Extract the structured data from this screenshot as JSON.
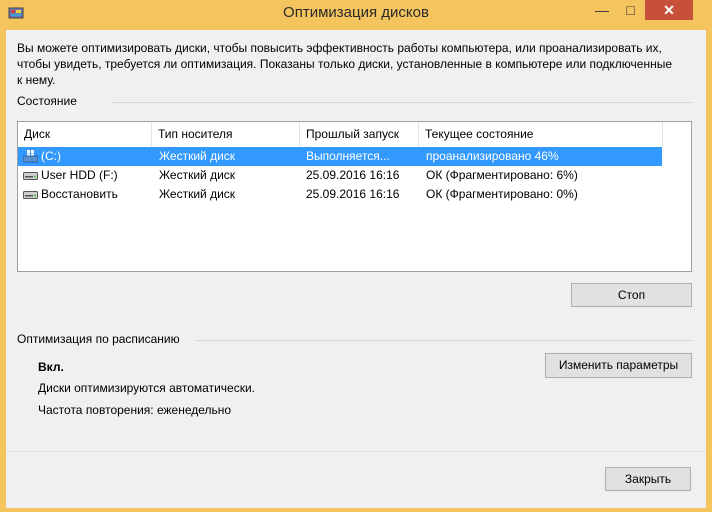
{
  "window": {
    "title": "Оптимизация дисков",
    "controls": {
      "minimize": "—",
      "maximize": "□",
      "close": "✕"
    }
  },
  "description": "Вы можете оптимизировать диски, чтобы повысить эффективность работы  компьютера, или проанализировать их, чтобы увидеть, требуется ли оптимизация. Показаны только диски, установленные в компьютере или подключенные к нему.",
  "status_section": {
    "title": "Состояние",
    "columns": [
      "Диск",
      "Тип носителя",
      "Прошлый запуск",
      "Текущее состояние"
    ],
    "rows": [
      {
        "disk": "(C:)",
        "media": "Жесткий диск",
        "last_run": "Выполняется...",
        "state": "проанализировано 46%",
        "icon": "windows-drive-icon",
        "selected": true
      },
      {
        "disk": "User HDD (F:)",
        "media": "Жесткий диск",
        "last_run": "25.09.2016 16:16",
        "state": "ОК (Фрагментировано: 6%)",
        "icon": "hard-drive-icon",
        "selected": false
      },
      {
        "disk": "Восстановить",
        "media": "Жесткий диск",
        "last_run": "25.09.2016 16:16",
        "state": "ОК (Фрагментировано: 0%)",
        "icon": "hard-drive-icon",
        "selected": false
      }
    ],
    "stop_button": "Стоп"
  },
  "schedule_section": {
    "title": "Оптимизация по расписанию",
    "status": "Вкл.",
    "auto_text": "Диски оптимизируются автоматически.",
    "frequency_text": "Частота повторения: еженедельно",
    "change_button": "Изменить параметры"
  },
  "footer": {
    "close_button": "Закрыть"
  },
  "colors": {
    "title_bar": "#f4c45e",
    "selection": "#3399ff",
    "close_button": "#c7503a",
    "window_bg": "#f0f0f0"
  }
}
